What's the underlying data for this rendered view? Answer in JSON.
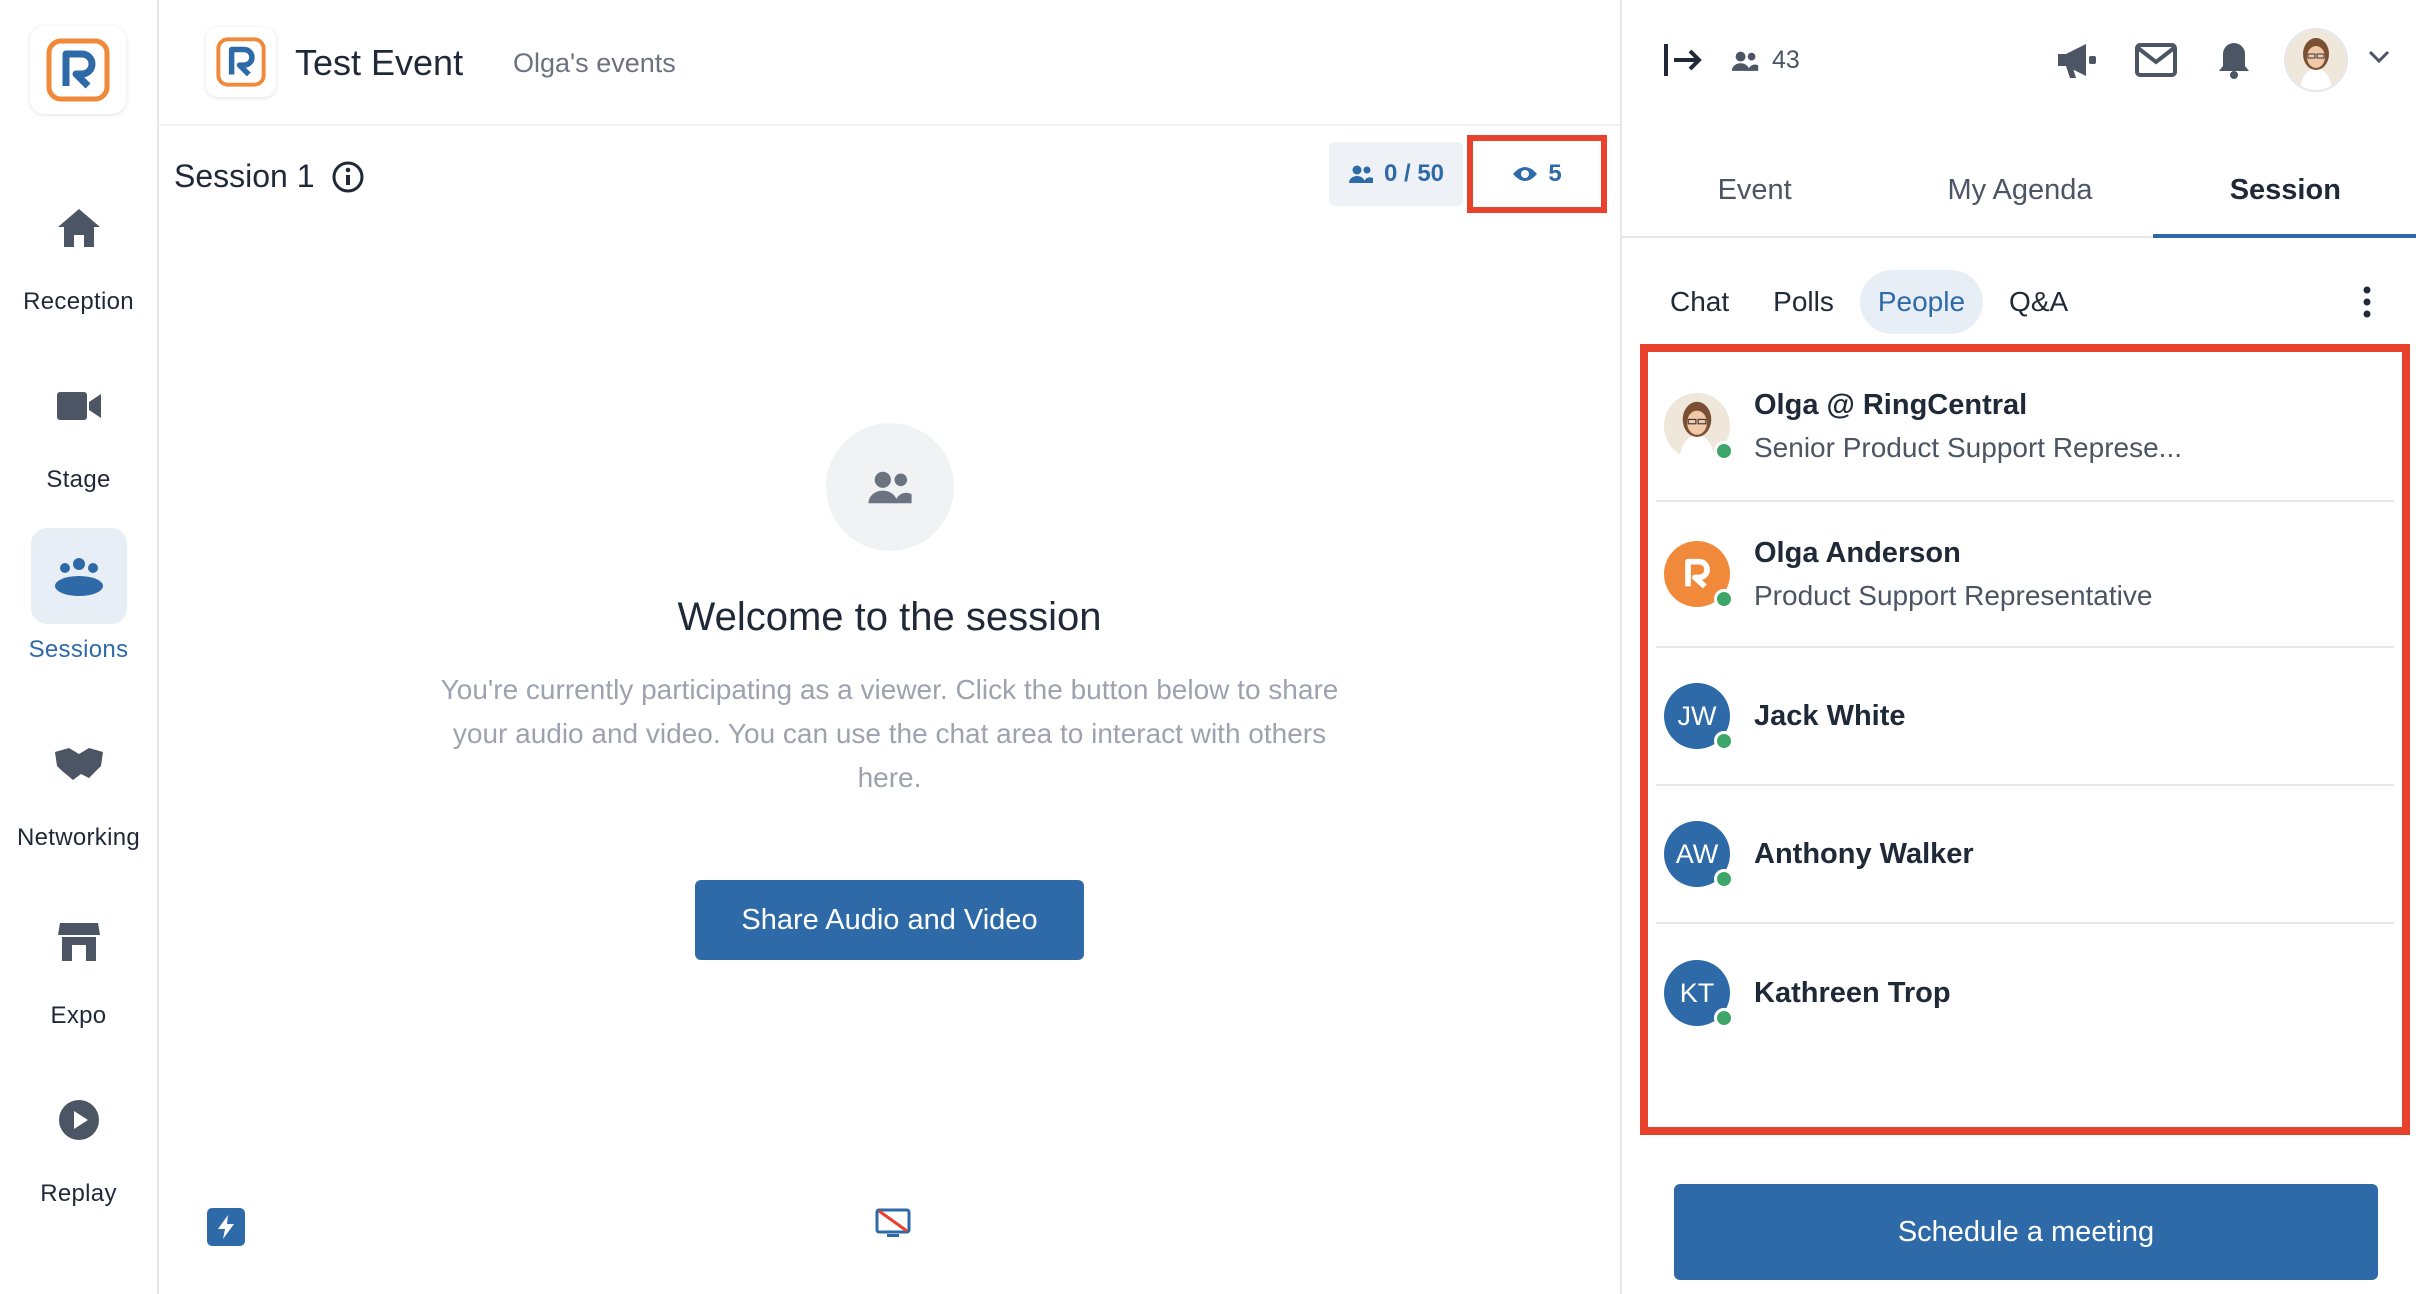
{
  "nav": {
    "items": [
      {
        "label": "Reception",
        "icon": "home-icon"
      },
      {
        "label": "Stage",
        "icon": "video-camera-icon"
      },
      {
        "label": "Sessions",
        "icon": "people-group-icon"
      },
      {
        "label": "Networking",
        "icon": "handshake-icon"
      },
      {
        "label": "Expo",
        "icon": "storefront-icon"
      },
      {
        "label": "Replay",
        "icon": "play-circle-icon"
      }
    ],
    "active": "Sessions"
  },
  "header": {
    "event_title": "Test Event",
    "org_link": "Olga's events"
  },
  "session": {
    "title": "Session 1",
    "seats": "0 / 50",
    "viewers": "5"
  },
  "welcome": {
    "title": "Welcome to the session",
    "text": "You're currently participating as a viewer. Click the button below to share your audio and video. You can use the chat area to interact with others here.",
    "button": "Share Audio and Video"
  },
  "panel": {
    "attendee_count": "43",
    "tabs": [
      "Event",
      "My Agenda",
      "Session"
    ],
    "active_tab": "Session",
    "subtabs": [
      "Chat",
      "Polls",
      "People",
      "Q&A"
    ],
    "active_subtab": "People",
    "people": [
      {
        "name": "Olga @ RingCentral",
        "role": "Senior Product Support Represe...",
        "initials": "",
        "avatar": "photo"
      },
      {
        "name": "Olga Anderson",
        "role": "Product Support Representative",
        "initials": "",
        "avatar": "logo"
      },
      {
        "name": "Jack White",
        "role": "",
        "initials": "JW",
        "avatar": "initials"
      },
      {
        "name": "Anthony Walker",
        "role": "",
        "initials": "AW",
        "avatar": "initials"
      },
      {
        "name": "Kathreen Trop",
        "role": "",
        "initials": "KT",
        "avatar": "initials"
      }
    ],
    "schedule_button": "Schedule a meeting"
  },
  "colors": {
    "brand": "#2f6aa8",
    "highlight": "#e8412c",
    "online": "#3fa66a",
    "logo_orange": "#f08a3a"
  }
}
